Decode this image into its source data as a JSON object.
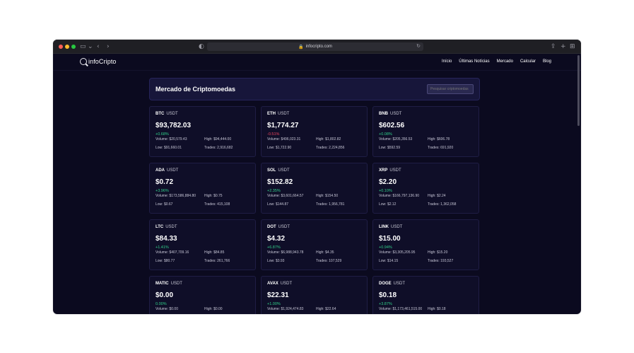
{
  "browser": {
    "url": "infocripto.com"
  },
  "site": {
    "logo_prefix": "info",
    "logo_suffix": "Cripto",
    "nav": [
      "Início",
      "Últimas Notícias",
      "Mercado",
      "Calcular",
      "Blog"
    ]
  },
  "market": {
    "title": "Mercado de Criptomoedas",
    "search_placeholder": "Pesquisar criptomoedas"
  },
  "labels": {
    "volume": "Volume:",
    "high": "High:",
    "low": "Low:",
    "trades": "Trades:"
  },
  "coins": [
    {
      "symbol": "BTC",
      "quote": "USDT",
      "price": "$93,782.03",
      "change": "+0.68%",
      "direction": "up",
      "volume": "$20,579.43",
      "high": "$94,444.00",
      "low": "$91,660.01",
      "trades": "2,916,682"
    },
    {
      "symbol": "ETH",
      "quote": "USDT",
      "price": "$1,774.27",
      "change": "-0.51%",
      "direction": "down",
      "volume": "$496,023.31",
      "high": "$1,802.82",
      "low": "$1,722.90",
      "trades": "2,224,856"
    },
    {
      "symbol": "BNB",
      "quote": "USDT",
      "price": "$602.56",
      "change": "+0.08%",
      "direction": "up",
      "volume": "$205,356.53",
      "high": "$606.78",
      "low": "$592.59",
      "trades": "691,920"
    },
    {
      "symbol": "ADA",
      "quote": "USDT",
      "price": "$0.72",
      "change": "+3.96%",
      "direction": "up",
      "volume": "$173,586,884.80",
      "high": "$0.75",
      "low": "$0.67",
      "trades": "415,108"
    },
    {
      "symbol": "SOL",
      "quote": "USDT",
      "price": "$152.82",
      "change": "+2.35%",
      "direction": "up",
      "volume": "$3,601,664.57",
      "high": "$154.50",
      "low": "$144.87",
      "trades": "1,956,781"
    },
    {
      "symbol": "XRP",
      "quote": "USDT",
      "price": "$2.20",
      "change": "+0.10%",
      "direction": "up",
      "volume": "$166,797,136.90",
      "high": "$2.24",
      "low": "$2.12",
      "trades": "1,362,058"
    },
    {
      "symbol": "LTC",
      "quote": "USDT",
      "price": "$84.33",
      "change": "+1.41%",
      "direction": "up",
      "volume": "$407,709.16",
      "high": "$84.85",
      "low": "$80.77",
      "trades": "261,766"
    },
    {
      "symbol": "DOT",
      "quote": "USDT",
      "price": "$4.32",
      "change": "+6.87%",
      "direction": "up",
      "volume": "$6,988,943.78",
      "high": "$4.35",
      "low": "$3.93",
      "trades": "107,529"
    },
    {
      "symbol": "LINK",
      "quote": "USDT",
      "price": "$15.00",
      "change": "+0.94%",
      "direction": "up",
      "volume": "$3,305,205.95",
      "high": "$15.20",
      "low": "$14.15",
      "trades": "193,527"
    },
    {
      "symbol": "MATIC",
      "quote": "USDT",
      "price": "$0.00",
      "change": "0.00%",
      "direction": "up",
      "volume": "$0.00",
      "high": "$0.00",
      "low": "",
      "trades": ""
    },
    {
      "symbol": "AVAX",
      "quote": "USDT",
      "price": "$22.31",
      "change": "+1.00%",
      "direction": "up",
      "volume": "$1,924,474.83",
      "high": "$22.64",
      "low": "",
      "trades": ""
    },
    {
      "symbol": "DOGE",
      "quote": "USDT",
      "price": "$0.18",
      "change": "+3.87%",
      "direction": "up",
      "volume": "$1,173,461,515.00",
      "high": "$0.18",
      "low": "",
      "trades": ""
    }
  ],
  "colors": {
    "up": "#31d089",
    "down": "#f0455f",
    "background": "#0b0a1f",
    "card": "#0f0e28"
  }
}
